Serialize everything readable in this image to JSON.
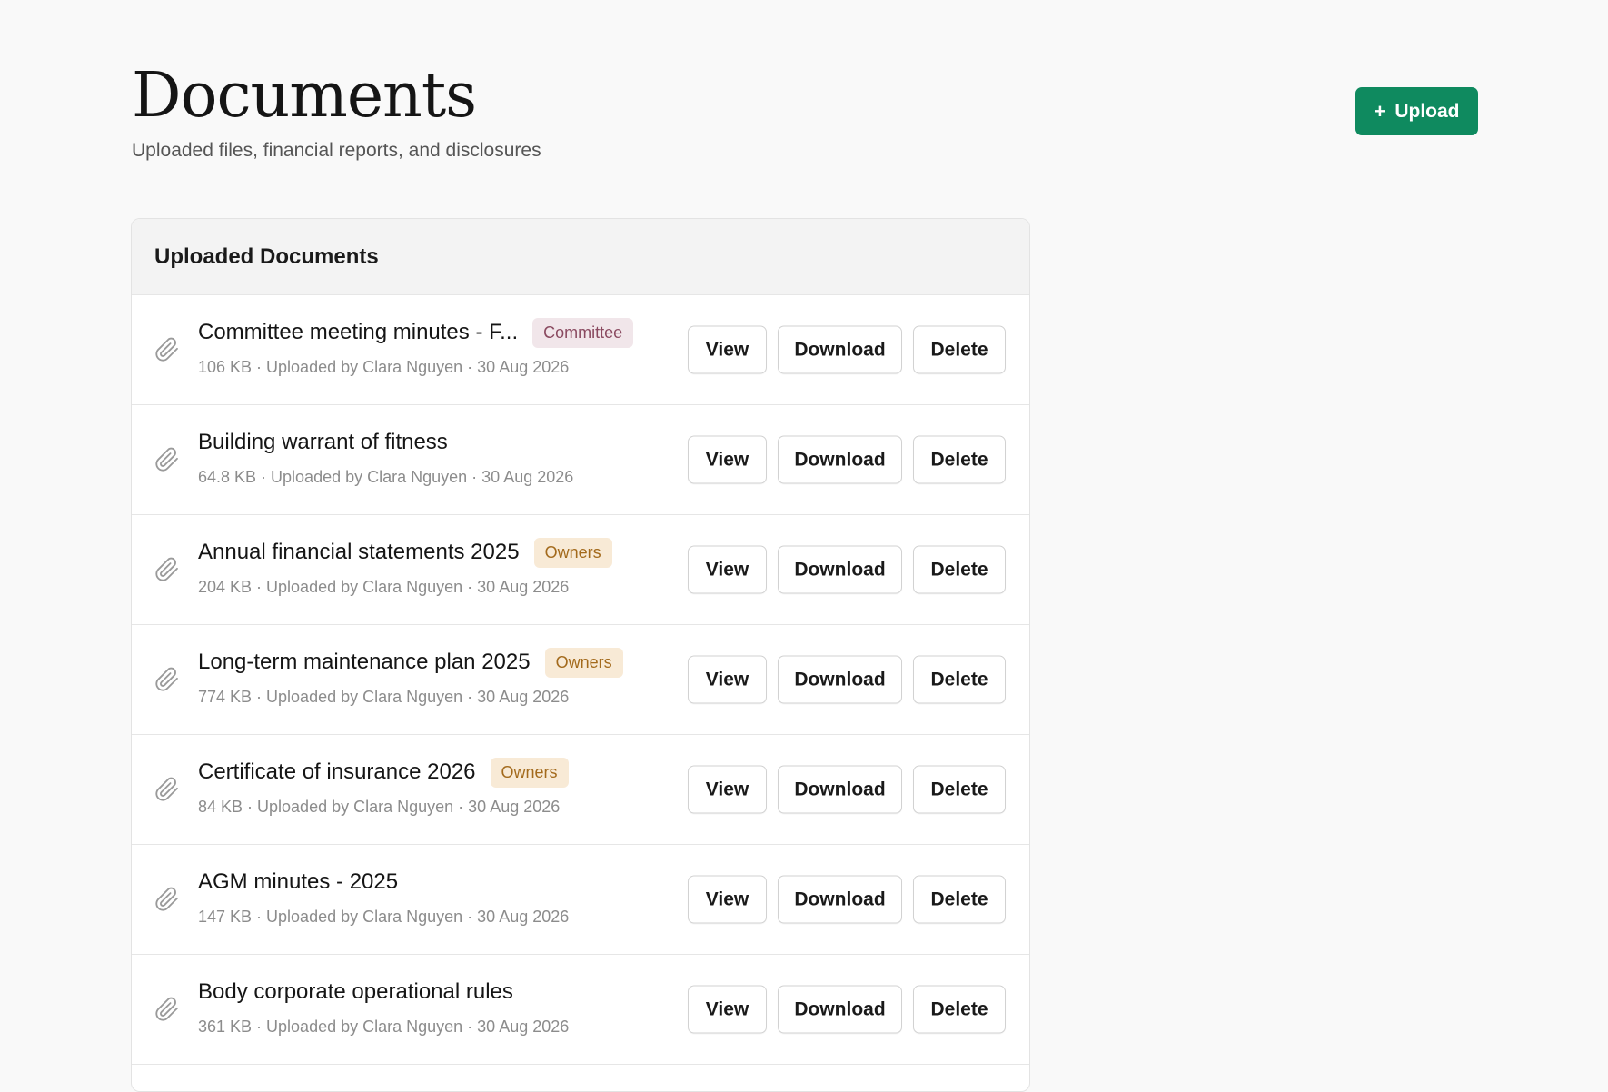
{
  "header": {
    "title": "Documents",
    "subtitle": "Uploaded files, financial reports, and disclosures",
    "upload_label": "Upload",
    "upload_icon": "+"
  },
  "card": {
    "title": "Uploaded Documents"
  },
  "actions": {
    "view": "View",
    "download": "Download",
    "delete": "Delete"
  },
  "documents": [
    {
      "title": "Committee meeting minutes - F...",
      "badge": "Committee",
      "meta": "106 KB · Uploaded by Clara Nguyen · 30 Aug 2026"
    },
    {
      "title": "Building warrant of fitness",
      "badge": "",
      "meta": "64.8 KB · Uploaded by Clara Nguyen · 30 Aug 2026"
    },
    {
      "title": "Annual financial statements 2025",
      "badge": "Owners",
      "meta": "204 KB · Uploaded by Clara Nguyen · 30 Aug 2026"
    },
    {
      "title": "Long-term maintenance plan 2025",
      "badge": "Owners",
      "meta": "774 KB · Uploaded by Clara Nguyen · 30 Aug 2026"
    },
    {
      "title": "Certificate of insurance 2026",
      "badge": "Owners",
      "meta": "84 KB · Uploaded by Clara Nguyen · 30 Aug 2026"
    },
    {
      "title": "AGM minutes - 2025",
      "badge": "",
      "meta": "147 KB · Uploaded by Clara Nguyen · 30 Aug 2026"
    },
    {
      "title": "Body corporate operational rules",
      "badge": "",
      "meta": "361 KB · Uploaded by Clara Nguyen · 30 Aug 2026"
    }
  ],
  "colors": {
    "accent": "#0f8a5f",
    "badge_committee_bg": "#f1e6ea",
    "badge_committee_text": "#8a4a60",
    "badge_owners_bg": "#f8ead6",
    "badge_owners_text": "#a36a1c"
  },
  "icons": {
    "document": "paperclip-icon"
  }
}
